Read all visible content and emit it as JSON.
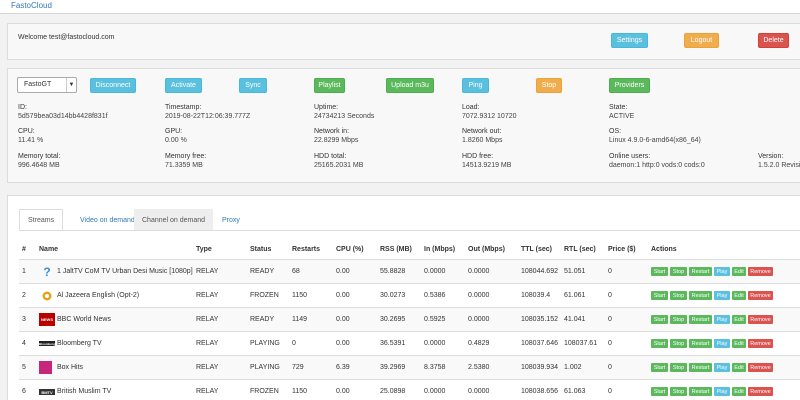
{
  "navbar": {
    "brand": "FastoCloud"
  },
  "welcome": {
    "text": "Welcome test@fastocloud.com",
    "buttons": {
      "settings": "Settings",
      "logout": "Logout",
      "delete": "Delete"
    }
  },
  "server": {
    "select_value": "FastoGT",
    "buttons": {
      "disconnect": "Disconnect",
      "activate": "Activate",
      "sync": "Sync",
      "playlist": "Playlist",
      "upload": "Upload m3u",
      "ping": "Ping",
      "stop": "Stop",
      "providers": "Providers"
    },
    "fields": [
      {
        "label": "ID:",
        "value": "5d579bea03d14bb4428f831f"
      },
      {
        "label": "Timestamp:",
        "value": "2019-08-22T12:06:39.777Z"
      },
      {
        "label": "Uptime:",
        "value": "24734213 Seconds"
      },
      {
        "label": "Load:",
        "value": "7072.9312 10720"
      },
      {
        "label": "State:",
        "value": "ACTIVE"
      },
      {
        "label": "CPU:",
        "value": "11.41 %"
      },
      {
        "label": "GPU:",
        "value": "0.00 %"
      },
      {
        "label": "Network in:",
        "value": "22.8299 Mbps"
      },
      {
        "label": "Network out:",
        "value": "1.8260 Mbps"
      },
      {
        "label": "OS:",
        "value": "Linux 4.9.0-6-amd64(x86_64)"
      },
      {
        "label": "Memory total:",
        "value": "996.4648 MB"
      },
      {
        "label": "Memory free:",
        "value": "71.3359 MB"
      },
      {
        "label": "HDD total:",
        "value": "25165.2031 MB"
      },
      {
        "label": "HDD free:",
        "value": "14513.9219 MB"
      },
      {
        "label": "Online users:",
        "value": "daemon:1 http:0 vods:0 cods:0"
      },
      {
        "label": "Version:",
        "value": "1.5.2.0 Revisi"
      }
    ]
  },
  "tabs": [
    "Streams",
    "Video on demand",
    "Channel on demand",
    "Proxy"
  ],
  "table": {
    "headers": [
      "#",
      "Name",
      "Type",
      "Status",
      "Restarts",
      "CPU (%)",
      "RSS (MB)",
      "In (Mbps)",
      "Out (Mbps)",
      "TTL (sec)",
      "RTL (sec)",
      "Price ($)",
      "Actions"
    ],
    "actions": [
      "Start",
      "Stop",
      "Restart",
      "Play",
      "Edit",
      "Remove"
    ],
    "rows": [
      {
        "num": "1",
        "name": "1 JaltTV CoM TV Urban Desi Music [1080p]",
        "logo": "question-icon",
        "type": "RELAY",
        "status": "READY",
        "restarts": "68",
        "cpu": "0.00",
        "rss": "55.8828",
        "in": "0.0000",
        "out": "0.0000",
        "ttl": "108044.692",
        "rtl": "51.051",
        "price": "0"
      },
      {
        "num": "2",
        "name": "Al Jazeera English (Opt-2)",
        "logo": "aljazeera-logo",
        "type": "RELAY",
        "status": "FROZEN",
        "restarts": "1150",
        "cpu": "0.00",
        "rss": "30.0273",
        "in": "0.5386",
        "out": "0.0000",
        "ttl": "108039.4",
        "rtl": "61.061",
        "price": "0"
      },
      {
        "num": "3",
        "name": "BBC World News",
        "logo": "bbc-logo",
        "type": "RELAY",
        "status": "READY",
        "restarts": "1149",
        "cpu": "0.00",
        "rss": "30.2695",
        "in": "0.5925",
        "out": "0.0000",
        "ttl": "108035.152",
        "rtl": "41.041",
        "price": "0"
      },
      {
        "num": "4",
        "name": "Bloomberg TV",
        "logo": "bloomberg-logo",
        "type": "RELAY",
        "status": "PLAYING",
        "restarts": "0",
        "cpu": "0.00",
        "rss": "36.5391",
        "in": "0.0000",
        "out": "0.4829",
        "ttl": "108037.646",
        "rtl": "108037.61",
        "price": "0"
      },
      {
        "num": "5",
        "name": "Box Hits",
        "logo": "boxhits-logo",
        "type": "RELAY",
        "status": "PLAYING",
        "restarts": "729",
        "cpu": "6.39",
        "rss": "39.2969",
        "in": "8.3758",
        "out": "2.5380",
        "ttl": "108039.934",
        "rtl": "1.002",
        "price": "0"
      },
      {
        "num": "6",
        "name": "British Muslim TV",
        "logo": "bmtv-logo",
        "type": "RELAY",
        "status": "FROZEN",
        "restarts": "1150",
        "cpu": "0.00",
        "rss": "25.0898",
        "in": "0.0000",
        "out": "0.0000",
        "ttl": "108038.656",
        "rtl": "61.063",
        "price": "0"
      }
    ]
  },
  "colors": {
    "info": "#5bc0de",
    "warning": "#f0ad4e",
    "danger": "#d9534f",
    "success": "#5cb85c",
    "link": "#337ab7"
  }
}
